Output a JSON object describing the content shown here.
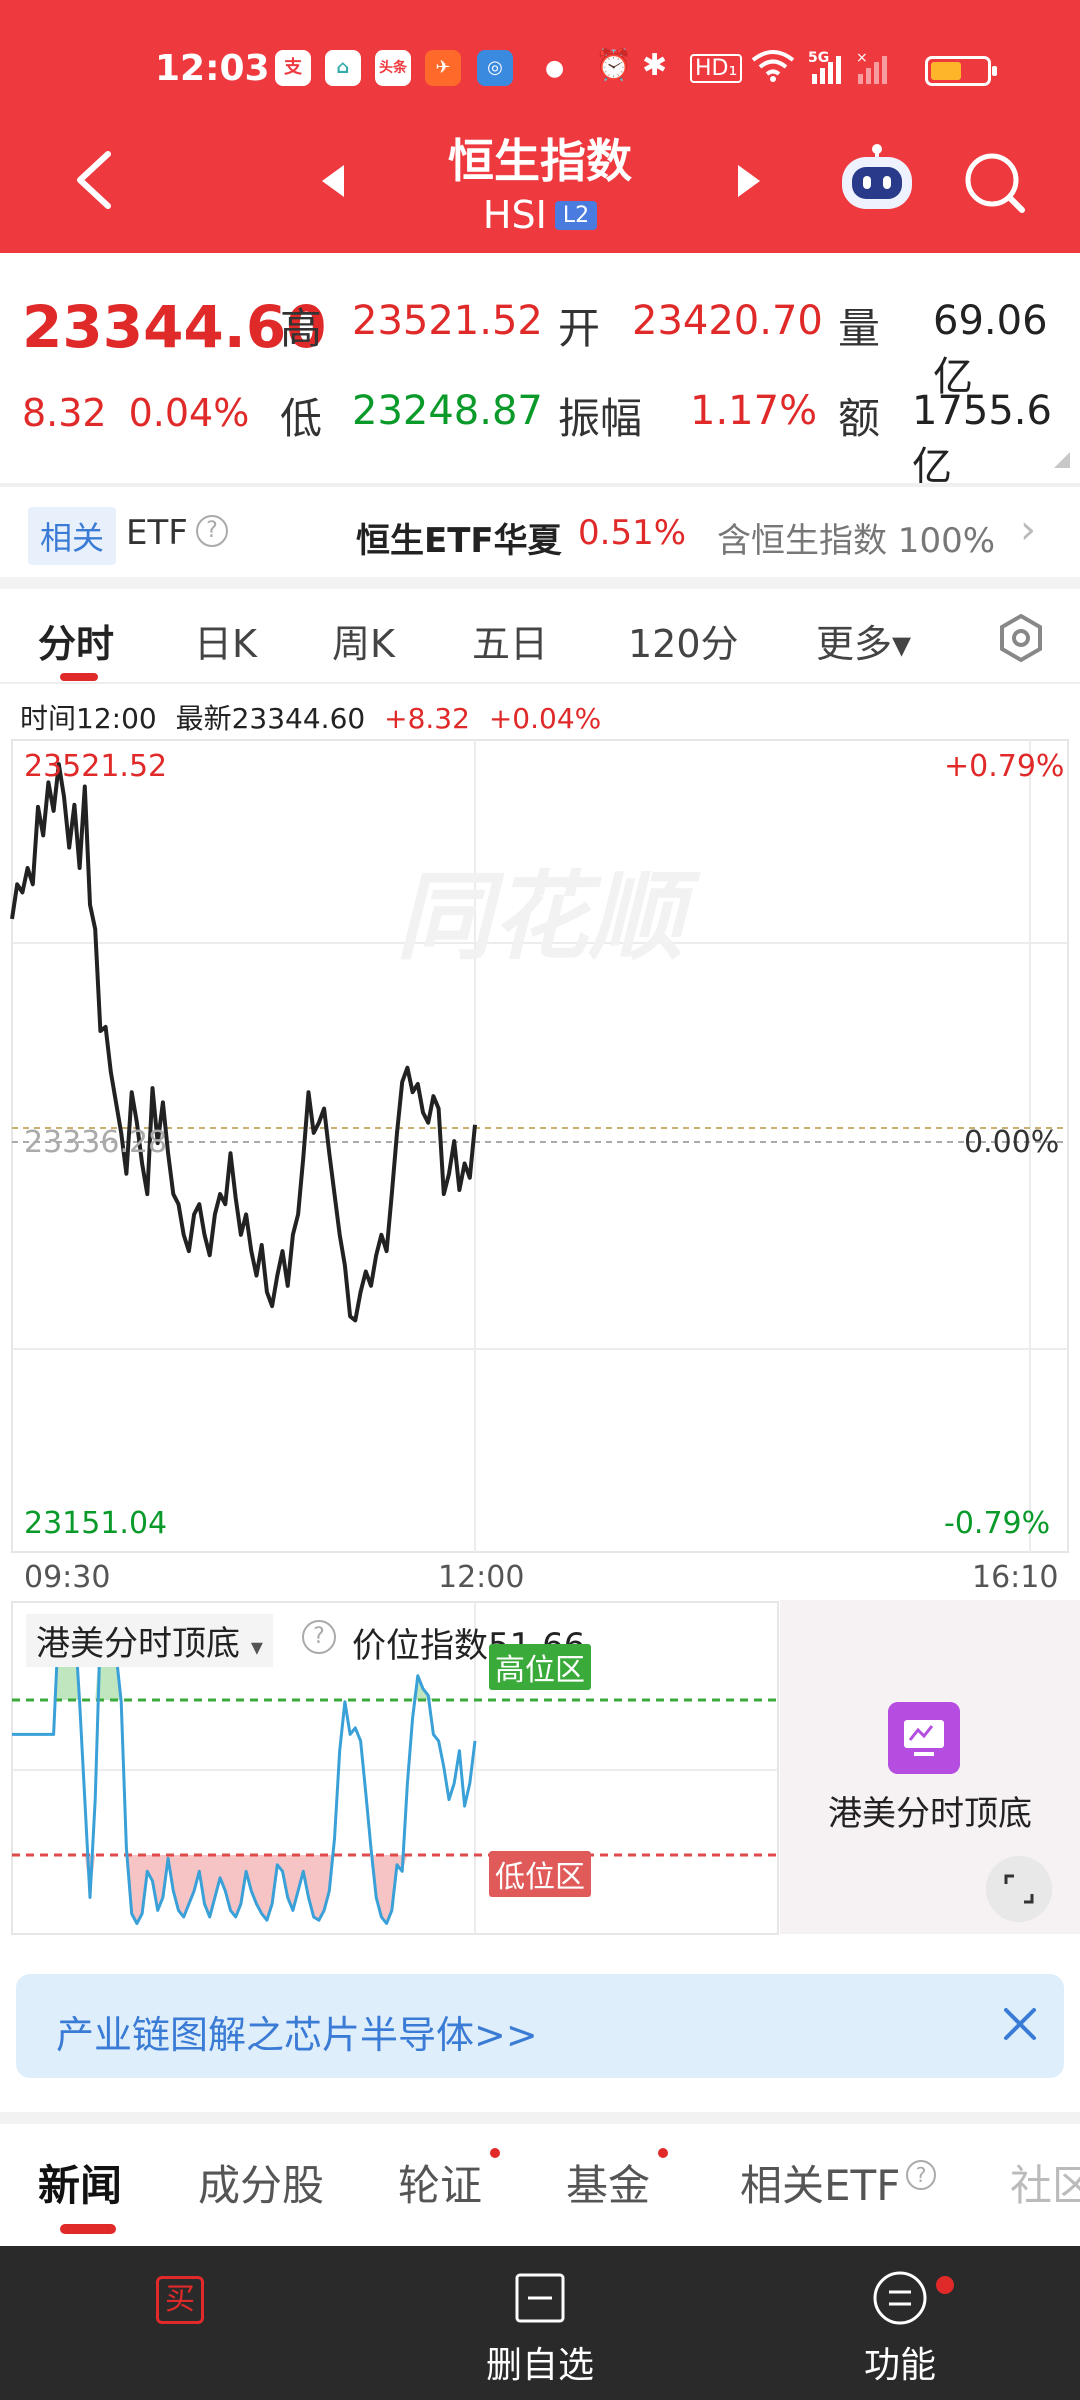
{
  "status_bar": {
    "time": "12:03",
    "icons": [
      "alipay-icon",
      "app-icon",
      "toutiao-icon",
      "app-icon",
      "app-icon",
      "dot-icon",
      "alarm-icon",
      "bluetooth-icon",
      "hd-icon",
      "wifi-icon",
      "signal-icon",
      "battery-icon"
    ],
    "hd_label": "HD₁",
    "net_label": "5G"
  },
  "header": {
    "title": "恒生指数",
    "code": "HSI",
    "level_badge": "L2",
    "bg_color": "#ee3a3f"
  },
  "quote": {
    "price": "23344.60",
    "change": "8.32",
    "change_pct": "0.04%",
    "high_label": "高",
    "high": "23521.52",
    "low_label": "低",
    "low": "23248.87",
    "open_label": "开",
    "open": "23420.70",
    "amplitude_label": "振幅",
    "amplitude": "1.17%",
    "volume_label": "量",
    "volume": "69.06亿",
    "turnover_label": "额",
    "turnover": "1755.6亿"
  },
  "etf_row": {
    "tag": "相关",
    "label": "ETF",
    "help": "?",
    "etf_name": "恒生ETF华夏",
    "etf_pct": "0.51%",
    "holding": "含恒生指数 100%"
  },
  "chart_tabs": {
    "items": [
      "分时",
      "日K",
      "周K",
      "五日",
      "120分",
      "更多▾"
    ],
    "active": 0
  },
  "chart_info": {
    "time": "时间12:00",
    "latest": "最新23344.60",
    "change": "+8.32",
    "change_pct": "+0.04%"
  },
  "chart_axis": {
    "top_price": "23521.52",
    "top_pct": "+0.79%",
    "mid_price": "23336.28",
    "mid_pct": "0.00%",
    "bottom_price": "23151.04",
    "bottom_pct": "-0.79%",
    "x_start": "09:30",
    "x_mid": "12:00",
    "x_end": "16:10"
  },
  "watermark": "同花顺",
  "chart_data": {
    "type": "line",
    "xlabel": "",
    "ylabel": "",
    "x_range": [
      "09:30",
      "16:10"
    ],
    "ylim": [
      23151.04,
      23521.52
    ],
    "prev_close": 23336.28,
    "series": [
      {
        "values": [
          23445,
          23462,
          23458,
          23470,
          23462,
          23500,
          23486,
          23512,
          23498,
          23521,
          23505,
          23480,
          23501,
          23470,
          23510,
          23452,
          23440,
          23390,
          23392,
          23370,
          23355,
          23340,
          23320,
          23360,
          23345,
          23325,
          23310,
          23362,
          23335,
          23355,
          23330,
          23310,
          23305,
          23290,
          23282,
          23300,
          23305,
          23290,
          23280,
          23300,
          23310,
          23305,
          23330,
          23308,
          23290,
          23300,
          23282,
          23270,
          23285,
          23262,
          23255,
          23270,
          23282,
          23265,
          23290,
          23300,
          23328,
          23360,
          23340,
          23345,
          23352,
          23330,
          23310,
          23290,
          23275,
          23250,
          23248,
          23262,
          23272,
          23265,
          23280,
          23290,
          23282,
          23310,
          23340,
          23365,
          23372,
          23360,
          23364,
          23350,
          23345,
          23358,
          23352,
          23310,
          23320,
          23336,
          23312,
          23325,
          23318,
          23344
        ]
      }
    ]
  },
  "indicator": {
    "name": "港美分时顶底",
    "help": "?",
    "value_label": "价位指数51.66",
    "high_zone": "高位区",
    "low_zone": "低位区",
    "promo_title": "港美分时顶底",
    "line_color": "#3aa0d8",
    "high_zone_color": "#3aaa3a",
    "low_zone_color": "#e04a4a",
    "values": [
      60,
      60,
      60,
      60,
      60,
      60,
      60,
      60,
      60,
      95,
      92,
      88,
      96,
      70,
      40,
      10,
      40,
      92,
      96,
      95,
      85,
      70,
      25,
      5,
      2,
      5,
      18,
      15,
      6,
      10,
      22,
      12,
      6,
      4,
      8,
      12,
      18,
      8,
      4,
      10,
      16,
      12,
      6,
      4,
      8,
      18,
      12,
      8,
      5,
      3,
      8,
      20,
      18,
      10,
      6,
      12,
      18,
      10,
      4,
      3,
      6,
      12,
      28,
      55,
      70,
      60,
      62,
      58,
      42,
      25,
      10,
      4,
      2,
      6,
      20,
      18,
      45,
      65,
      78,
      74,
      72,
      60,
      58,
      50,
      40,
      45,
      55,
      38,
      45,
      58
    ]
  },
  "banner": {
    "text": "产业链图解之芯片半导体>>"
  },
  "news_tabs": {
    "items": [
      "新闻",
      "成分股",
      "轮证",
      "基金",
      "相关ETF",
      "社区"
    ],
    "active": 0
  },
  "bottom_bar": {
    "buy_label": "买",
    "remove_label": "删自选",
    "function_label": "功能"
  }
}
